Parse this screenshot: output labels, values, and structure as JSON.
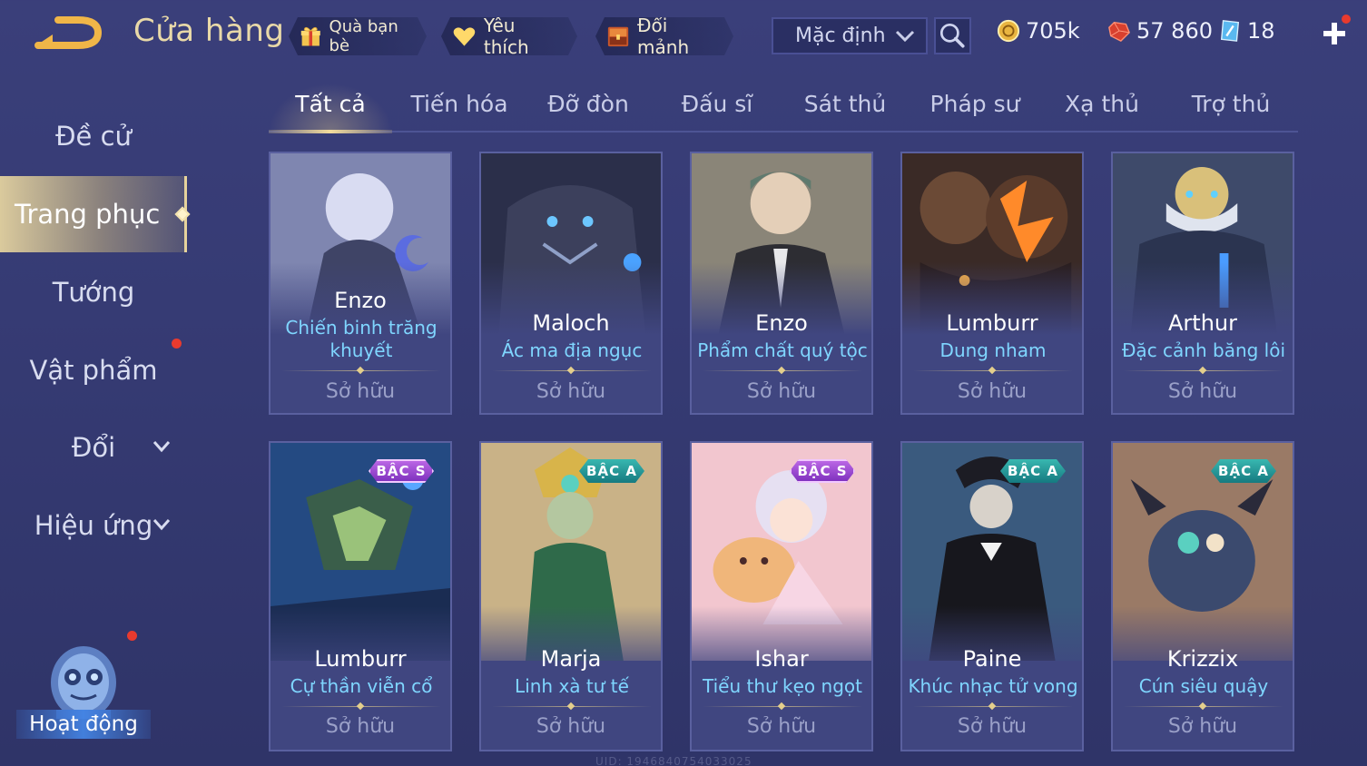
{
  "header": {
    "title": "Cửa hàng",
    "gift_label": "Quà bạn bè",
    "favorite_label": "Yêu thích",
    "trade_label": "Đổi mảnh",
    "sort_value": "Mặc định"
  },
  "currency": {
    "gold": "705k",
    "ruby": "57 860",
    "voucher": "18"
  },
  "sidebar": {
    "items": [
      {
        "label": "Đề cử"
      },
      {
        "label": "Trang phục"
      },
      {
        "label": "Tướng"
      },
      {
        "label": "Vật phẩm"
      },
      {
        "label": "Đổi"
      },
      {
        "label": "Hiệu ứng"
      }
    ],
    "activity_label": "Hoạt động"
  },
  "tabs": [
    "Tất cả",
    "Tiến hóa",
    "Đỡ đòn",
    "Đấu sĩ",
    "Sát thủ",
    "Pháp sư",
    "Xạ thủ",
    "Trợ thủ"
  ],
  "cards": [
    {
      "hero": "Enzo",
      "skin_line1": "Chiến binh trăng",
      "skin_line2": "khuyết",
      "status": "Sở hữu",
      "tier": ""
    },
    {
      "hero": "Maloch",
      "skin_line1": "Ác ma địa ngục",
      "skin_line2": "",
      "status": "Sở hữu",
      "tier": ""
    },
    {
      "hero": "Enzo",
      "skin_line1": "Phẩm chất quý tộc",
      "skin_line2": "",
      "status": "Sở hữu",
      "tier": ""
    },
    {
      "hero": "Lumburr",
      "skin_line1": "Dung nham",
      "skin_line2": "",
      "status": "Sở hữu",
      "tier": ""
    },
    {
      "hero": "Arthur",
      "skin_line1": "Đặc cảnh băng lôi",
      "skin_line2": "",
      "status": "Sở hữu",
      "tier": ""
    },
    {
      "hero": "Lumburr",
      "skin_line1": "Cự thần viễn cổ",
      "skin_line2": "",
      "status": "Sở hữu",
      "tier": "BẬC S"
    },
    {
      "hero": "Marja",
      "skin_line1": "Linh xà tư tế",
      "skin_line2": "",
      "status": "Sở hữu",
      "tier": "BẬC A"
    },
    {
      "hero": "Ishar",
      "skin_line1": "Tiểu thư kẹo ngọt",
      "skin_line2": "",
      "status": "Sở hữu",
      "tier": "BẬC S"
    },
    {
      "hero": "Paine",
      "skin_line1": "Khúc nhạc tử vong",
      "skin_line2": "",
      "status": "Sở hữu",
      "tier": "BẬC A"
    },
    {
      "hero": "Krizzix",
      "skin_line1": "Cún siêu quậy",
      "skin_line2": "",
      "status": "Sở hữu",
      "tier": "BẬC A"
    }
  ],
  "uid_text": "UID: 1946840754033025",
  "colors": {
    "accent_gold": "#e9d9a8",
    "skin_name": "#7fd6ff",
    "notification": "#e83a2e",
    "tier_s": "#a44fd8",
    "tier_a": "#2a9a99"
  }
}
